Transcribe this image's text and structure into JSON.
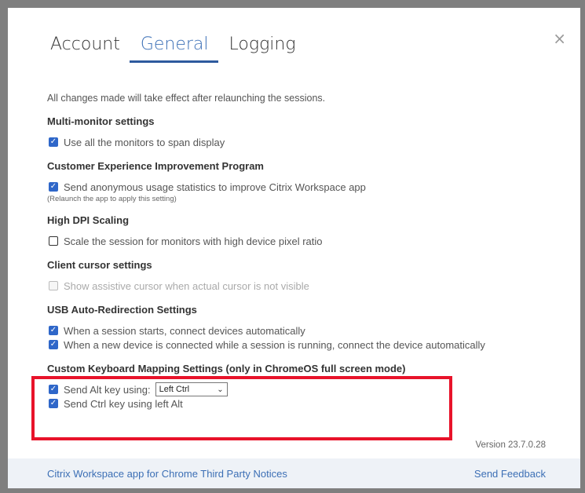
{
  "tabs": [
    {
      "label": "Account"
    },
    {
      "label": "General"
    },
    {
      "label": "Logging"
    }
  ],
  "close_label": "×",
  "note": "All changes made will take effect after relaunching the sessions.",
  "sections": {
    "multi_monitor": {
      "title": "Multi-monitor settings",
      "items": [
        {
          "label": "Use all the monitors to span display",
          "checked": true
        }
      ]
    },
    "ceip": {
      "title": "Customer Experience Improvement Program",
      "items": [
        {
          "label": "Send anonymous usage statistics to improve Citrix Workspace app",
          "checked": true
        }
      ],
      "subnote": "(Relaunch the app to apply this setting)"
    },
    "high_dpi": {
      "title": "High DPI Scaling",
      "items": [
        {
          "label": "Scale the session for monitors with high device pixel ratio",
          "checked": false
        }
      ]
    },
    "cursor": {
      "title": "Client cursor settings",
      "items": [
        {
          "label": "Show assistive cursor when actual cursor is not visible",
          "checked": false,
          "disabled": true
        }
      ]
    },
    "usb": {
      "title": "USB Auto-Redirection Settings",
      "items": [
        {
          "label": "When a session starts, connect devices automatically",
          "checked": true
        },
        {
          "label": "When a new device is connected while a session is running, connect the device automatically",
          "checked": true
        }
      ]
    },
    "keyboard": {
      "title": "Custom Keyboard Mapping Settings (only in ChromeOS full screen mode)",
      "items": [
        {
          "label": "Send Alt key using:",
          "checked": true
        },
        {
          "label": "Send Ctrl key using left Alt",
          "checked": true
        }
      ],
      "alt_select_value": "Left Ctrl"
    }
  },
  "version": "Version 23.7.0.28",
  "footer": {
    "notices_link": "Citrix Workspace app for Chrome Third Party Notices",
    "feedback_link": "Send Feedback"
  },
  "colors": {
    "accent": "#3b6fb6",
    "checkbox": "#2f67c9",
    "highlight": "#e8132a",
    "footer_bg": "#eef2f7"
  }
}
